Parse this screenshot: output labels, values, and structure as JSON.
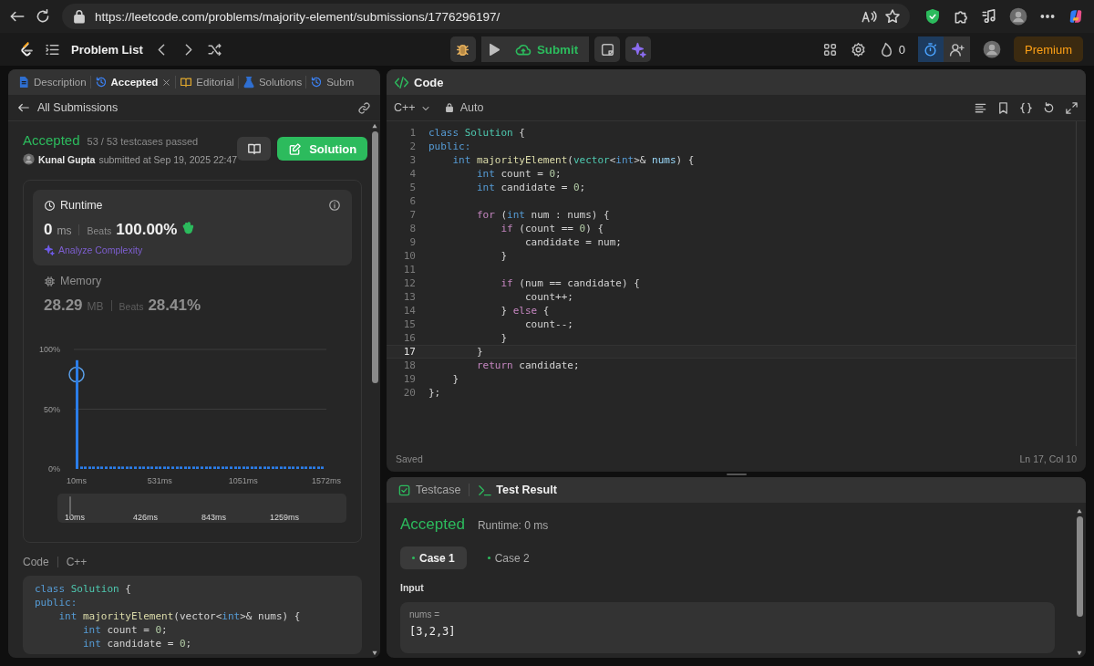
{
  "browser": {
    "url": "https://leetcode.com/problems/majority-element/submissions/1776296197/"
  },
  "nav": {
    "problem_list": "Problem List",
    "submit": "Submit",
    "streak": "0",
    "premium": "Premium"
  },
  "left_tabs": [
    {
      "label": "Description",
      "selected": false,
      "closable": false
    },
    {
      "label": "Accepted",
      "selected": true,
      "closable": true
    },
    {
      "label": "Editorial",
      "selected": false,
      "closable": false
    },
    {
      "label": "Solutions",
      "selected": false,
      "closable": false
    },
    {
      "label": "Subm",
      "selected": false,
      "closable": false
    }
  ],
  "back_link": "All Submissions",
  "submission": {
    "status": "Accepted",
    "tests": "53 / 53 testcases passed",
    "author": "Kunal Gupta",
    "submitted": "submitted at Sep 19, 2025 22:47",
    "solution_button": "Solution"
  },
  "metrics": [
    {
      "title": "Runtime",
      "value": "0",
      "unit": "ms",
      "beats_label": "Beats",
      "beats": "100.00%",
      "analyze": "Analyze Complexity",
      "selected": true
    },
    {
      "title": "Memory",
      "value": "28.29",
      "unit": "MB",
      "beats_label": "Beats",
      "beats": "28.41%",
      "selected": false
    }
  ],
  "runtime_chart": {
    "y_labels": [
      "100%",
      "50%",
      "0%"
    ],
    "x_labels": [
      "10ms",
      "531ms",
      "1051ms",
      "1572ms"
    ]
  },
  "range": {
    "labels": [
      "10ms",
      "426ms",
      "843ms",
      "1259ms"
    ]
  },
  "code_preview": {
    "label": "Code",
    "language": "C++",
    "lines": [
      [
        {
          "text": "class ",
          "kind": "kw"
        },
        {
          "text": "Solution",
          "kind": "type"
        },
        {
          "text": " {"
        }
      ],
      [
        {
          "text": "public:",
          "kind": "kw"
        }
      ],
      [
        {
          "text": "    int ",
          "kind": "kw"
        },
        {
          "text": "majorityElement",
          "kind": "fn"
        },
        {
          "text": "(vector<"
        },
        {
          "text": "int",
          "kind": "kw"
        },
        {
          "text": ">& nums) {"
        }
      ],
      [
        {
          "text": "        int",
          "kind": "kw"
        },
        {
          "text": " count = "
        },
        {
          "text": "0",
          "kind": "num"
        },
        {
          "text": ";"
        }
      ],
      [
        {
          "text": "        int",
          "kind": "kw"
        },
        {
          "text": " candidate = "
        },
        {
          "text": "0",
          "kind": "num"
        },
        {
          "text": ";"
        }
      ]
    ]
  },
  "editor": {
    "title": "Code",
    "language": "C++",
    "mode": "Auto",
    "lines": [
      {
        "n": "1",
        "active": false,
        "tokens": [
          {
            "text": "class ",
            "kind": "kw"
          },
          {
            "text": "Solution",
            "kind": "type"
          },
          {
            "text": " {"
          }
        ]
      },
      {
        "n": "2",
        "active": false,
        "tokens": [
          {
            "text": "public:",
            "kind": "kw"
          }
        ]
      },
      {
        "n": "3",
        "active": false,
        "tokens": [
          {
            "text": "    int ",
            "kind": "kw"
          },
          {
            "text": "majorityElement",
            "kind": "fn"
          },
          {
            "text": "("
          },
          {
            "text": "vector",
            "kind": "type"
          },
          {
            "text": "<"
          },
          {
            "text": "int",
            "kind": "kw"
          },
          {
            "text": ">& "
          },
          {
            "text": "nums",
            "kind": "var"
          },
          {
            "text": ") {"
          }
        ]
      },
      {
        "n": "4",
        "active": false,
        "tokens": [
          {
            "text": "        int",
            "kind": "kw"
          },
          {
            "text": " count = "
          },
          {
            "text": "0",
            "kind": "num"
          },
          {
            "text": ";"
          }
        ]
      },
      {
        "n": "5",
        "active": false,
        "tokens": [
          {
            "text": "        int",
            "kind": "kw"
          },
          {
            "text": " candidate = "
          },
          {
            "text": "0",
            "kind": "num"
          },
          {
            "text": ";"
          }
        ]
      },
      {
        "n": "6",
        "active": false
      },
      {
        "n": "7",
        "active": false,
        "tokens": [
          {
            "text": "        for",
            "kind": "ctl"
          },
          {
            "text": " ("
          },
          {
            "text": "int",
            "kind": "kw"
          },
          {
            "text": " num : nums) {"
          }
        ]
      },
      {
        "n": "8",
        "active": false,
        "tokens": [
          {
            "text": "            if",
            "kind": "ctl"
          },
          {
            "text": " (count == "
          },
          {
            "text": "0",
            "kind": "num"
          },
          {
            "text": ") {"
          }
        ]
      },
      {
        "n": "9",
        "active": false,
        "tokens": [
          {
            "text": "                candidate = num;"
          }
        ]
      },
      {
        "n": "10",
        "active": false,
        "tokens": [
          {
            "text": "            }"
          }
        ]
      },
      {
        "n": "11",
        "active": false
      },
      {
        "n": "12",
        "active": false,
        "tokens": [
          {
            "text": "            if",
            "kind": "ctl"
          },
          {
            "text": " (num == candidate) {"
          }
        ]
      },
      {
        "n": "13",
        "active": false,
        "tokens": [
          {
            "text": "                count++;"
          }
        ]
      },
      {
        "n": "14",
        "active": false,
        "tokens": [
          {
            "text": "            } "
          },
          {
            "text": "else",
            "kind": "ctl"
          },
          {
            "text": " {"
          }
        ]
      },
      {
        "n": "15",
        "active": false,
        "tokens": [
          {
            "text": "                count--;"
          }
        ]
      },
      {
        "n": "16",
        "active": false,
        "tokens": [
          {
            "text": "            }"
          }
        ]
      },
      {
        "n": "17",
        "active": true,
        "tokens": [
          {
            "text": "        }"
          }
        ]
      },
      {
        "n": "18",
        "active": false,
        "tokens": [
          {
            "text": "        return",
            "kind": "ctl"
          },
          {
            "text": " candidate;"
          }
        ]
      },
      {
        "n": "19",
        "active": false,
        "tokens": [
          {
            "text": "    }"
          }
        ]
      },
      {
        "n": "20",
        "active": false,
        "tokens": [
          {
            "text": "};"
          }
        ]
      }
    ],
    "status": "Saved",
    "cursor": "Ln 17, Col 10"
  },
  "result": {
    "tabs": [
      {
        "label": "Testcase",
        "selected": false
      },
      {
        "label": "Test Result",
        "selected": true
      }
    ],
    "status": "Accepted",
    "runtime": "Runtime: 0 ms",
    "cases": [
      {
        "label": "Case 1",
        "selected": true
      },
      {
        "label": "Case 2",
        "selected": false
      }
    ],
    "input_label": "Input",
    "param": "nums =",
    "value": "[3,2,3]"
  }
}
